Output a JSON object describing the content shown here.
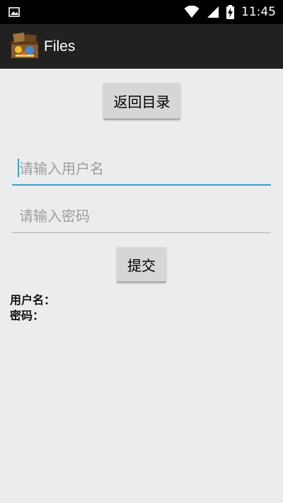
{
  "status_bar": {
    "time": "11:45",
    "icons": [
      "image-icon",
      "wifi-icon",
      "signal-icon",
      "battery-charging-icon"
    ]
  },
  "app_bar": {
    "title": "Files",
    "icon": "treasure-chest-app-icon"
  },
  "main": {
    "back_button_label": "返回目录",
    "username_placeholder": "请输入用户名",
    "password_placeholder": "请输入密码",
    "submit_button_label": "提交",
    "username_label": "用户名：",
    "password_label": "密码："
  },
  "colors": {
    "focus_accent": "#3aa0c8",
    "app_bar": "#212121",
    "background": "#ececec"
  }
}
